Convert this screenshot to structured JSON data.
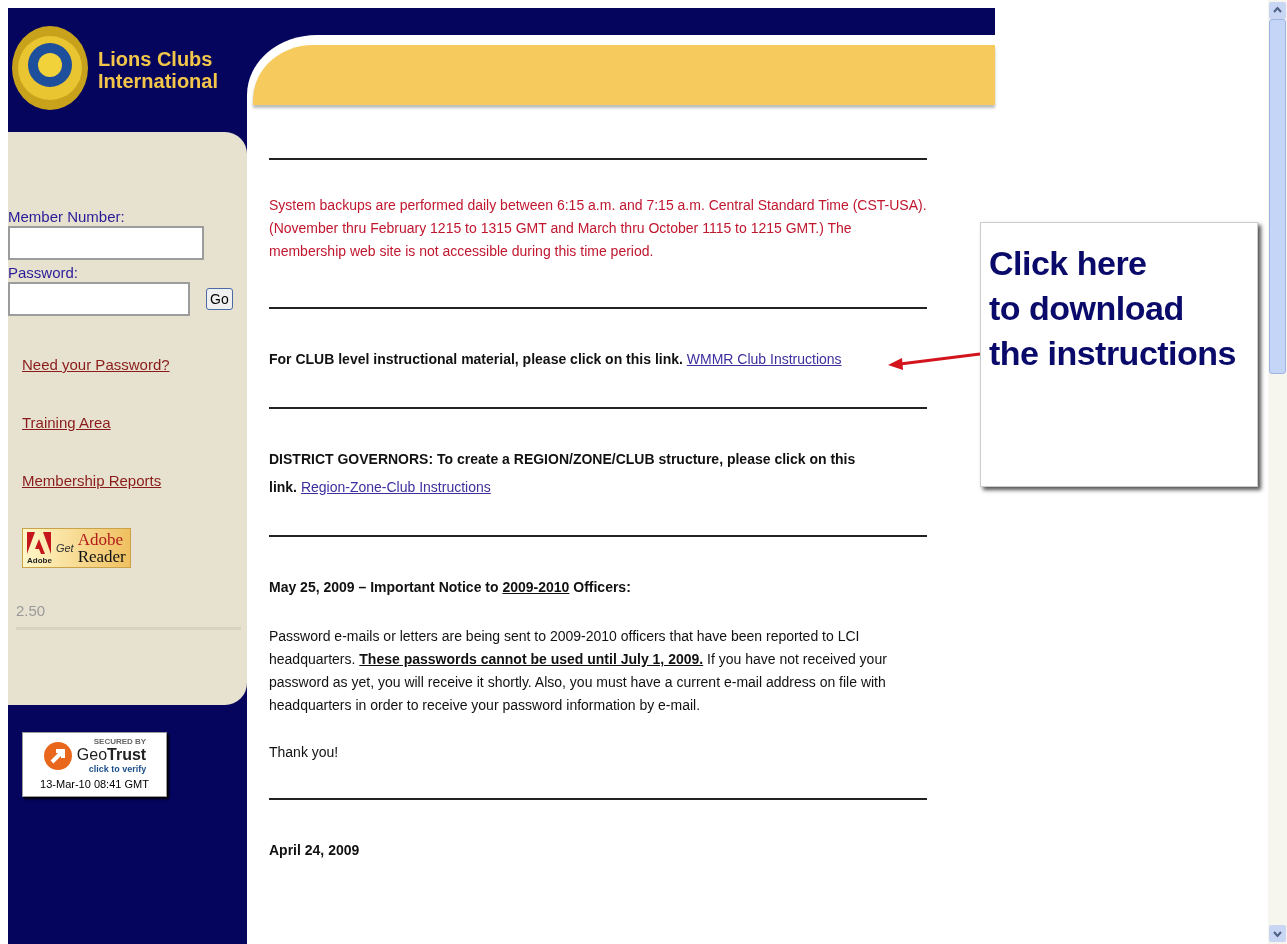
{
  "sidebar": {
    "brand": [
      "Lions Clubs",
      "International"
    ],
    "login": {
      "member_label": "Member Number:",
      "password_label": "Password:",
      "go_button": "Go"
    },
    "links": [
      {
        "label": "Need your Password?"
      },
      {
        "label": "Training Area"
      },
      {
        "label": "Membership Reports"
      }
    ],
    "adobe_badge": {
      "brand": "Adobe",
      "get": "Get",
      "product": [
        "Adobe",
        "Reader"
      ]
    },
    "version": "2.50",
    "geotrust": {
      "secured_by": "SECURED BY",
      "brand": "Geo**Trust**",
      "verify": "click to verify",
      "timestamp": "13-Mar-10 08:41 GMT"
    }
  },
  "notices": [
    {
      "kind": "alert",
      "text": "System backups are performed daily between 6:15 a.m. and 7:15 a.m. Central Standard Time (CST-USA). (November thru February 1215 to 1315 GMT and March thru October 1115 to 1215 GMT.) The membership web site is not accessible during this time period."
    },
    {
      "kind": "link",
      "text": "For CLUB level instructional material, please click on this link.",
      "link": "WMMR Club Instructions"
    },
    {
      "kind": "link",
      "text": "DISTRICT GOVERNORS: To create a REGION/ZONE/CLUB structure, please click on this link.",
      "link": "Region-Zone-Club Instructions"
    },
    {
      "kind": "notice",
      "heading_start": "May 25, 2009 – Important Notice to ",
      "heading_underlined": "2009-2010",
      "heading_end": " Officers:",
      "body": "Password e-mails or letters are being sent to 2009-2010 officers that have been reported to LCI headquarters. **These passwords cannot be used until July 1, 2009.** If you have not received your password as yet, you will receive it shortly. Also, you must have a current e-mail address on file with headquarters in order to receive your password information by e-mail.",
      "closing": "Thank you!"
    },
    {
      "kind": "date",
      "text": "April 24, 2009"
    }
  ],
  "callout": {
    "lines": [
      "Click here",
      "to download",
      "the instructions"
    ]
  }
}
